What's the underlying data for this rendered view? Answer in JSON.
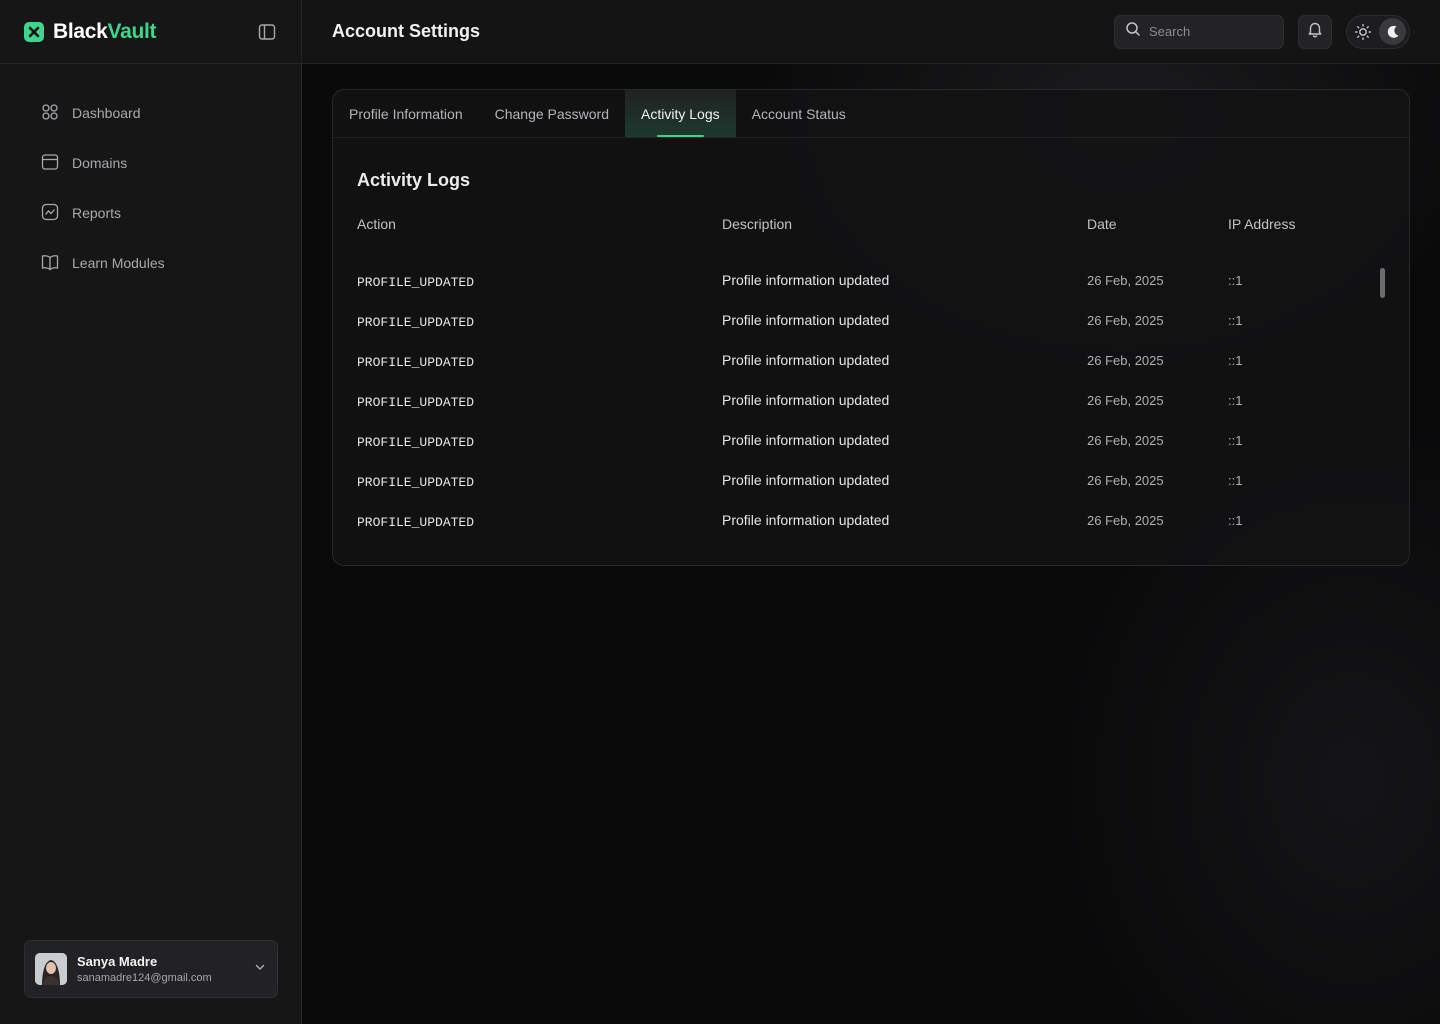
{
  "brand": {
    "name_part1": "Black",
    "name_part2": "Vault",
    "accent_color": "#3ed68c"
  },
  "sidebar": {
    "items": [
      {
        "label": "Dashboard",
        "icon": "grid-icon"
      },
      {
        "label": "Domains",
        "icon": "browser-window-icon"
      },
      {
        "label": "Reports",
        "icon": "chart-line-icon"
      },
      {
        "label": "Learn Modules",
        "icon": "book-open-icon"
      }
    ],
    "user": {
      "name": "Sanya Madre",
      "email": "sanamadre124@gmail.com"
    }
  },
  "header": {
    "title": "Account Settings",
    "search_placeholder": "Search"
  },
  "tabs": [
    {
      "label": "Profile Information",
      "active": false
    },
    {
      "label": "Change Password",
      "active": false
    },
    {
      "label": "Activity Logs",
      "active": true
    },
    {
      "label": "Account Status",
      "active": false
    }
  ],
  "activity_logs": {
    "title": "Activity Logs",
    "columns": [
      "Action",
      "Description",
      "Date",
      "IP Address"
    ],
    "rows": [
      {
        "action": "PROFILE_UPDATED",
        "description": "Profile information updated",
        "date": "26 Feb, 2025",
        "ip": "::1"
      },
      {
        "action": "PROFILE_UPDATED",
        "description": "Profile information updated",
        "date": "26 Feb, 2025",
        "ip": "::1"
      },
      {
        "action": "PROFILE_UPDATED",
        "description": "Profile information updated",
        "date": "26 Feb, 2025",
        "ip": "::1"
      },
      {
        "action": "PROFILE_UPDATED",
        "description": "Profile information updated",
        "date": "26 Feb, 2025",
        "ip": "::1"
      },
      {
        "action": "PROFILE_UPDATED",
        "description": "Profile information updated",
        "date": "26 Feb, 2025",
        "ip": "::1"
      },
      {
        "action": "PROFILE_UPDATED",
        "description": "Profile information updated",
        "date": "26 Feb, 2025",
        "ip": "::1"
      },
      {
        "action": "PROFILE_UPDATED",
        "description": "Profile information updated",
        "date": "26 Feb, 2025",
        "ip": "::1"
      }
    ]
  }
}
